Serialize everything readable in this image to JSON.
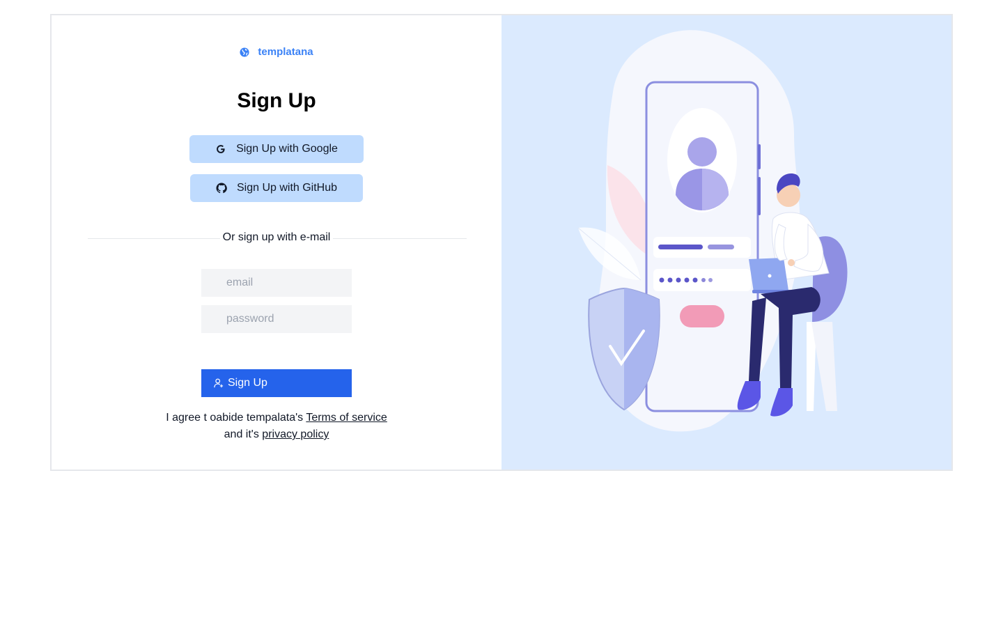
{
  "brand": {
    "name": "templatana",
    "icon": "globe-icon"
  },
  "title": "Sign Up",
  "oauth": {
    "google_label": "Sign Up with Google",
    "github_label": "Sign Up with GitHub"
  },
  "divider_text": "Or sign up with e-mail",
  "form": {
    "email_placeholder": "email",
    "password_placeholder": "password",
    "submit_label": "Sign Up"
  },
  "terms": {
    "line1_prefix": "I agree t oabide tempalata's ",
    "terms_link": "Terms of service",
    "line2_prefix": "and it's ",
    "privacy_link": "privacy policy"
  },
  "colors": {
    "accent": "#2563eb",
    "brand": "#3b82f6",
    "oauth_bg": "#bfdbfe",
    "illustration_bg": "#dbeafe"
  }
}
